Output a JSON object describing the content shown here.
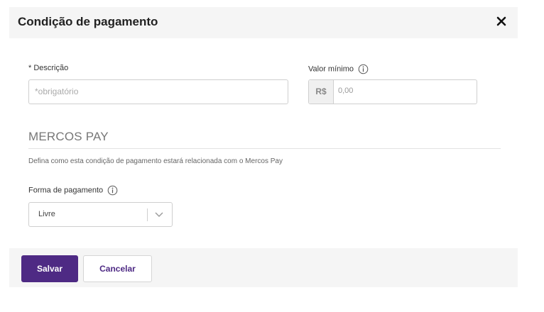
{
  "modal": {
    "title": "Condição de pagamento",
    "close_icon": "close-icon"
  },
  "form": {
    "descricao": {
      "label": "* Descrição",
      "placeholder": "*obrigatório",
      "value": ""
    },
    "valor_minimo": {
      "label": "Valor mínimo",
      "prefix": "R$",
      "value": "0,00",
      "info_icon": "info-icon"
    }
  },
  "mercos_pay": {
    "title": "MERCOS PAY",
    "description": "Defina como esta condição de pagamento estará relacionada com o Mercos Pay",
    "forma_pagamento": {
      "label": "Forma de pagamento",
      "selected": "Livre",
      "info_icon": "info-icon",
      "arrow_icon": "chevron-down-icon"
    }
  },
  "footer": {
    "save_label": "Salvar",
    "cancel_label": "Cancelar"
  },
  "colors": {
    "primary": "#4e2a84",
    "header_bg": "#f5f5f5"
  }
}
